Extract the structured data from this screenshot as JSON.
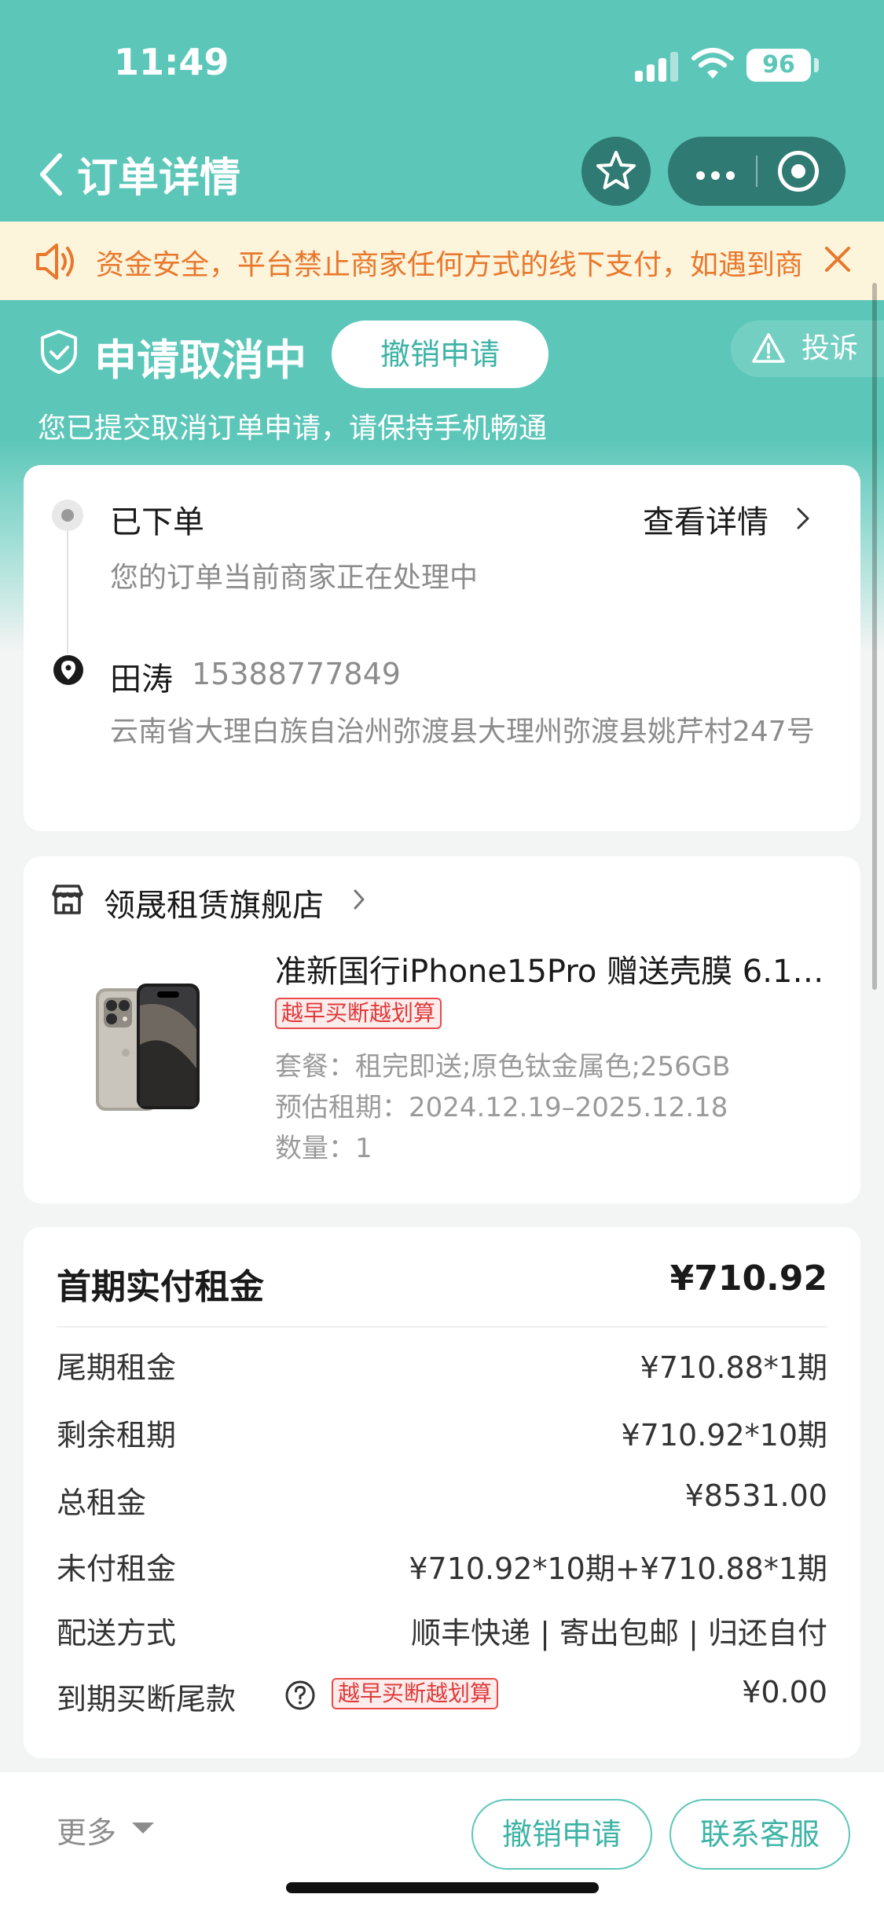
{
  "status_bar": {
    "time": "11:49",
    "battery": "96"
  },
  "nav": {
    "title": "订单详情"
  },
  "notice": {
    "text": "资金安全，平台禁止商家任何方式的线下支付，如遇到商"
  },
  "order_status": {
    "title": "申请取消中",
    "revoke_label": "撤销申请",
    "complain_label": "投诉",
    "subtitle": "您已提交取消订单申请，请保持手机畅通"
  },
  "progress": {
    "step_title": "已下单",
    "step_desc": "您的订单当前商家正在处理中",
    "view_detail": "查看详情",
    "receiver_name": "田涛",
    "receiver_phone": "15388777849",
    "address": "云南省大理白族自治州弥渡县大理州弥渡县姚芹村247号"
  },
  "product": {
    "store_name": "领晟租赁旗舰店",
    "title": "准新国行iPhone15Pro 赠送壳膜 6.1…",
    "tag": "越早买断越划算",
    "package": "套餐：租完即送;原色钛金属色;256GB",
    "rental_period": "预估租期：2024.12.19–2025.12.18",
    "quantity": "数量：1"
  },
  "fees": {
    "first_label": "首期实付租金",
    "first_value": "¥710.92",
    "rows": [
      {
        "label": "尾期租金",
        "value": "¥710.88*1期"
      },
      {
        "label": "剩余租期",
        "value": "¥710.92*10期"
      },
      {
        "label": "总租金",
        "value": "¥8531.00"
      },
      {
        "label": "未付租金",
        "value": "¥710.92*10期+¥710.88*1期"
      },
      {
        "label": "配送方式",
        "value": "顺丰快递 | 寄出包邮 | 归还自付"
      },
      {
        "label": "到期买断尾款",
        "value": "¥0.00",
        "tag": "越早买断越划算"
      }
    ]
  },
  "bottom": {
    "more_label": "更多",
    "revoke_label": "撤销申请",
    "service_label": "联系客服"
  },
  "colors": {
    "primary": "#5cc7b9",
    "notice_text": "#e8782c",
    "tag_red": "#e03a3a"
  }
}
